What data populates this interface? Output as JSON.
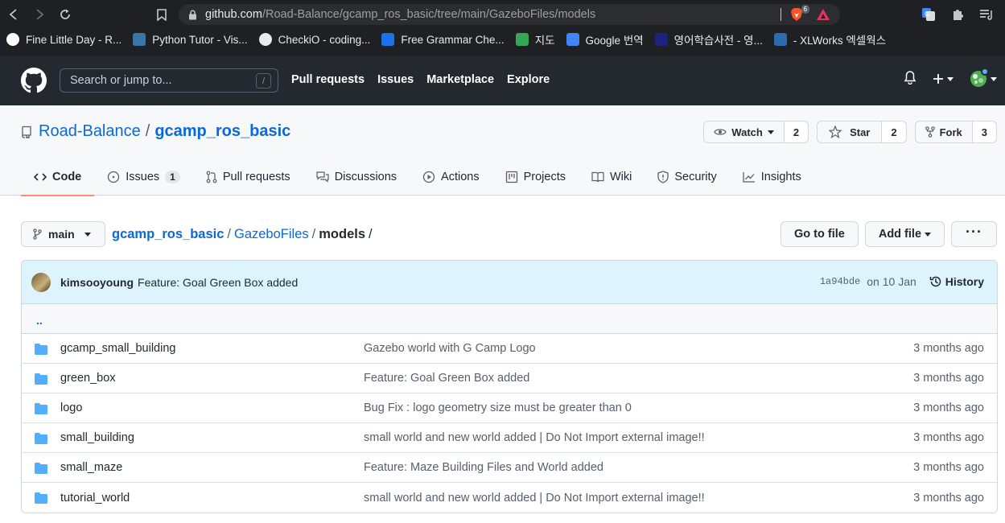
{
  "browser": {
    "url_domain": "github.com",
    "url_path": "/Road-Balance/gcamp_ros_basic/tree/main/GazeboFiles/models",
    "brave_count": "6",
    "bookmarks": [
      {
        "label": "Fine Little Day - R...",
        "icon": "fine-little-day-icon"
      },
      {
        "label": "Python Tutor - Vis...",
        "icon": "python-icon"
      },
      {
        "label": "CheckiO - coding...",
        "icon": "checkio-icon"
      },
      {
        "label": "Free Grammar Che...",
        "icon": "grammar-icon"
      },
      {
        "label": "지도",
        "icon": "maps-icon"
      },
      {
        "label": "Google 번역",
        "icon": "translate-icon"
      },
      {
        "label": "영어학습사전 - 영...",
        "icon": "dictionary-icon"
      },
      {
        "label": "- XLWorks 엑셀웍스",
        "icon": "xlworks-icon"
      }
    ]
  },
  "github": {
    "search_placeholder": "Search or jump to...",
    "search_key": "/",
    "nav": [
      "Pull requests",
      "Issues",
      "Marketplace",
      "Explore"
    ]
  },
  "repo": {
    "owner": "Road-Balance",
    "name": "gcamp_ros_basic",
    "watch_label": "Watch",
    "watch_count": "2",
    "star_label": "Star",
    "star_count": "2",
    "fork_label": "Fork",
    "fork_count": "3",
    "tabs": [
      {
        "label": "Code",
        "icon": "code-icon",
        "selected": true
      },
      {
        "label": "Issues",
        "icon": "issue-icon",
        "badge": "1"
      },
      {
        "label": "Pull requests",
        "icon": "pull-request-icon"
      },
      {
        "label": "Discussions",
        "icon": "discussion-icon"
      },
      {
        "label": "Actions",
        "icon": "play-icon"
      },
      {
        "label": "Projects",
        "icon": "project-icon"
      },
      {
        "label": "Wiki",
        "icon": "book-icon"
      },
      {
        "label": "Security",
        "icon": "shield-icon"
      },
      {
        "label": "Insights",
        "icon": "graph-icon"
      }
    ]
  },
  "path": {
    "branch": "main",
    "crumbs": [
      "gcamp_ros_basic",
      "GazeboFiles"
    ],
    "current": "models",
    "go_to_file": "Go to file",
    "add_file": "Add file",
    "more": "···"
  },
  "commit": {
    "author": "kimsooyoung",
    "message": "Feature: Goal Green Box added",
    "sha": "1a94bde",
    "date": "on 10 Jan",
    "history": "History"
  },
  "files": {
    "up": "..",
    "rows": [
      {
        "name": "gcamp_small_building",
        "message": "Gazebo world with G Camp Logo",
        "age": "3 months ago"
      },
      {
        "name": "green_box",
        "message": "Feature: Goal Green Box added",
        "age": "3 months ago"
      },
      {
        "name": "logo",
        "message": "Bug Fix : logo geometry size must be greater than 0",
        "age": "3 months ago"
      },
      {
        "name": "small_building",
        "message": "small world and new world added | Do Not Import external image!!",
        "age": "3 months ago"
      },
      {
        "name": "small_maze",
        "message": "Feature: Maze Building Files and World added",
        "age": "3 months ago"
      },
      {
        "name": "tutorial_world",
        "message": "small world and new world added | Do Not Import external image!!",
        "age": "3 months ago"
      }
    ]
  }
}
